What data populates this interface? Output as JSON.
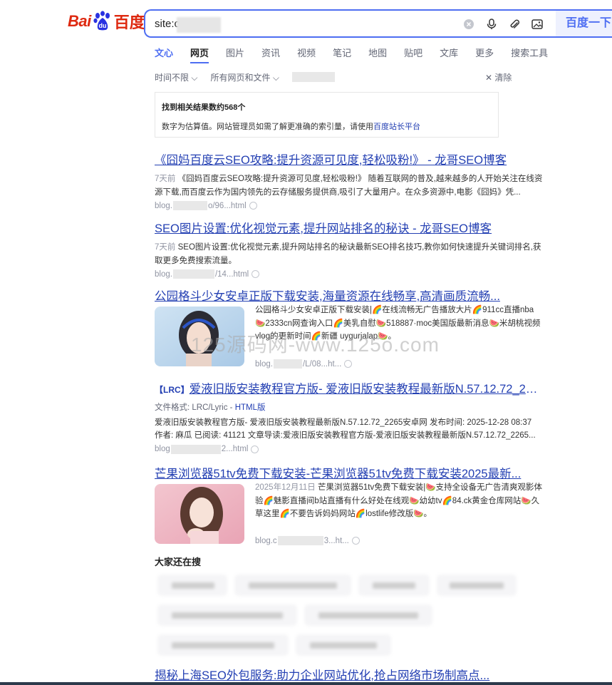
{
  "logo": {
    "latin": "Bai",
    "paw": "du",
    "chinese": "百度"
  },
  "search": {
    "query": "site:c",
    "button": "百度一下"
  },
  "tabs": [
    "文心",
    "网页",
    "图片",
    "资讯",
    "视频",
    "笔记",
    "地图",
    "贴吧",
    "文库",
    "更多",
    "搜索工具"
  ],
  "filters": {
    "time": "时间不限",
    "scope": "所有网页和文件",
    "clear": "清除"
  },
  "tip": {
    "count": "找到相关结果数约568个",
    "note": "数字为估算值。网站管理员如需了解更准确的索引量，请使用",
    "link": "百度站长平台"
  },
  "results": [
    {
      "title": "《囧妈百度云SEO攻略:提升资源可见度,轻松吸粉!》 - 龙哥SEO博客",
      "date": "7天前",
      "abstract": "《囧妈百度云SEO攻略:提升资源可见度,轻松吸粉!》 随着互联网的普及,越来越多的人开始关注在线资源下载,而百度云作为国内领先的云存储服务提供商,吸引了大量用户。在众多资源中,电影《囧妈》凭...",
      "url_prefix": "blog.",
      "url_suffix": "o/96...html"
    },
    {
      "title": "SEO图片设置:优化视觉元素,提升网站排名的秘诀 - 龙哥SEO博客",
      "date": "7天前",
      "abstract": "SEO图片设置:优化视觉元素,提升网站排名的秘诀最新SEO排名技巧,教你如何快速提升关键词排名,获取更多免费搜索流量。",
      "url_prefix": "blog.",
      "url_suffix": "/14...html"
    },
    {
      "title": "公园格斗少女安卓正版下载安装,海量资源在线畅享,高清画质流畅...",
      "abstract": "公园格斗少女安卓正版下载安装|🌈在线流畅无广告播放大片🌈911cc直播nba🍉2333cn网查询入口🌈美乳自慰🍉518887·moc美国版最新消息🍉米胡桃视频vlog的更新时间🌈新疆 uygurjalap🍉。",
      "url_prefix": "blog.",
      "url_suffix": "/L/08...ht..."
    },
    {
      "tag": "【LRC】",
      "title": "爱液旧版安装教程官方版- 爱液旧版安装教程最新版N.57.12.72_226...",
      "format_label": "文件格式:",
      "format_value": "LRC/Lyric -",
      "format_link": "HTML版",
      "line1": "爱液旧版安装教程官方版- 爱液旧版安装教程最新版N.57.12.72_2265安卓网 发布时间: 2025-12-28 08:37",
      "line2": "作者: 麻瓜 已阅读: 41121 文章导读:爱液旧版安装教程官方版-爱液旧版安装教程最新版N.57.12.72_2265...",
      "url_prefix": "blog",
      "url_suffix": "2...html"
    },
    {
      "title": "芒果浏览器51tv免费下载安装-芒果浏览器51tv免费下载安装2025最新...",
      "date": "2025年12月11日",
      "abstract": "芒果浏览器51tv免费下载安装|🍉支持全设备无广告清爽观影体验🌈魅影直播间b站直播有什么好处在线观🍉幼幼tv🌈84.ck黄金仓库网站🍉久草这里🌈不要告诉妈妈网站🌈lostlife修改版🍉。",
      "url_prefix": "blog.c",
      "url_suffix": "3...ht..."
    }
  ],
  "also_search": {
    "title": "大家还在搜"
  },
  "last_result": {
    "title": "揭秘上海SEO外包服务:助力企业网站优化,抢占网络市场制高点..."
  },
  "watermark": "125源码网-www.125o.com",
  "colors": {
    "brand_red": "#de2910",
    "brand_blue": "#4e6ef2",
    "link": "#2440b3"
  }
}
